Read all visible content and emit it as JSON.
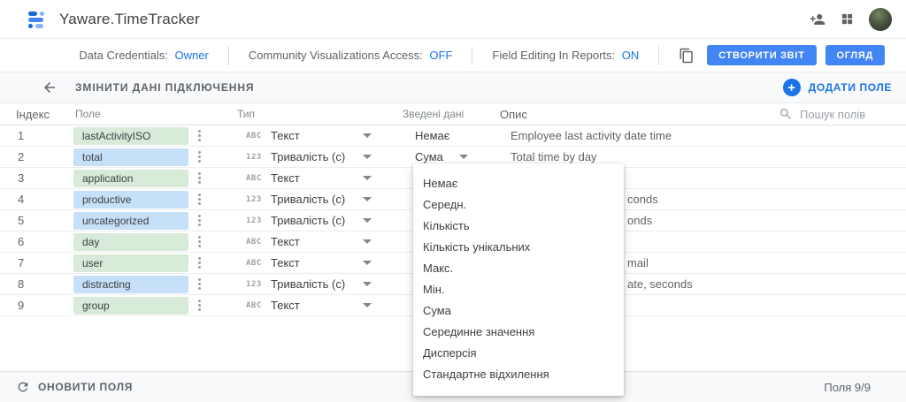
{
  "header": {
    "app_title": "Yaware.TimeTracker"
  },
  "toolbar": {
    "settings": [
      {
        "label": "Data Credentials:",
        "value": "Owner"
      },
      {
        "label": "Community Visualizations Access:",
        "value": "OFF"
      },
      {
        "label": "Field Editing In Reports:",
        "value": "ON"
      }
    ],
    "create_report_label": "СТВОРИТИ ЗВІТ",
    "overview_label": "ОГЛЯД"
  },
  "subheader": {
    "title": "ЗМІНИТИ ДАНІ ПІДКЛЮЧЕННЯ",
    "add_field_label": "ДОДАТИ ПОЛЕ"
  },
  "table": {
    "columns": {
      "index": "Індекс",
      "field": "Поле",
      "type": "Тип",
      "aggregation": "Зведені дані",
      "description": "Опис"
    },
    "search_placeholder": "Пошук полів",
    "rows": [
      {
        "index": "1",
        "field": "lastActivityISO",
        "kind": "dimension",
        "type_icon": "ABC",
        "type": "Текст",
        "aggregation": "Немає",
        "agg_caret": false,
        "description": "Employee last activity date time",
        "desc_offset": false
      },
      {
        "index": "2",
        "field": "total",
        "kind": "metric",
        "type_icon": "123",
        "type": "Тривалість (с)",
        "aggregation": "Сума",
        "agg_caret": true,
        "description": "Total time by day",
        "desc_offset": false
      },
      {
        "index": "3",
        "field": "application",
        "kind": "dimension",
        "type_icon": "ABC",
        "type": "Текст",
        "aggregation": "",
        "agg_caret": false,
        "description": "",
        "desc_offset": false
      },
      {
        "index": "4",
        "field": "productive",
        "kind": "metric",
        "type_icon": "123",
        "type": "Тривалість (с)",
        "aggregation": "",
        "agg_caret": false,
        "description": "conds",
        "desc_offset": true
      },
      {
        "index": "5",
        "field": "uncategorized",
        "kind": "metric",
        "type_icon": "123",
        "type": "Тривалість (с)",
        "aggregation": "",
        "agg_caret": false,
        "description": "onds",
        "desc_offset": true
      },
      {
        "index": "6",
        "field": "day",
        "kind": "dimension",
        "type_icon": "ABC",
        "type": "Текст",
        "aggregation": "",
        "agg_caret": false,
        "description": "",
        "desc_offset": false
      },
      {
        "index": "7",
        "field": "user",
        "kind": "dimension",
        "type_icon": "ABC",
        "type": "Текст",
        "aggregation": "",
        "agg_caret": false,
        "description": "mail",
        "desc_offset": true
      },
      {
        "index": "8",
        "field": "distracting",
        "kind": "metric",
        "type_icon": "123",
        "type": "Тривалість (с)",
        "aggregation": "",
        "agg_caret": false,
        "description": "ate, seconds",
        "desc_offset": true
      },
      {
        "index": "9",
        "field": "group",
        "kind": "dimension",
        "type_icon": "ABC",
        "type": "Текст",
        "aggregation": "",
        "agg_caret": false,
        "description": "",
        "desc_offset": false
      }
    ]
  },
  "aggregation_menu": {
    "items": [
      "Немає",
      "Середн.",
      "Кількість",
      "Кількість унікальних",
      "Макс.",
      "Мін.",
      "Сума",
      "Серединне значення",
      "Дисперсія",
      "Стандартне відхилення"
    ]
  },
  "footer": {
    "refresh_label": "ОНОВИТИ ПОЛЯ",
    "field_count": "Поля 9/9"
  },
  "ui_icons": [
    "data-studio-logo",
    "person-add",
    "apps-grid",
    "avatar",
    "copy",
    "back-arrow",
    "add-circle-plus",
    "search",
    "kebab-menu",
    "dropdown-caret",
    "refresh"
  ],
  "colors": {
    "accent_blue": "#4285f4",
    "link_blue": "#1a73e8",
    "dimension_chip": "#d7ebd8",
    "metric_chip": "#c6e0f8"
  }
}
